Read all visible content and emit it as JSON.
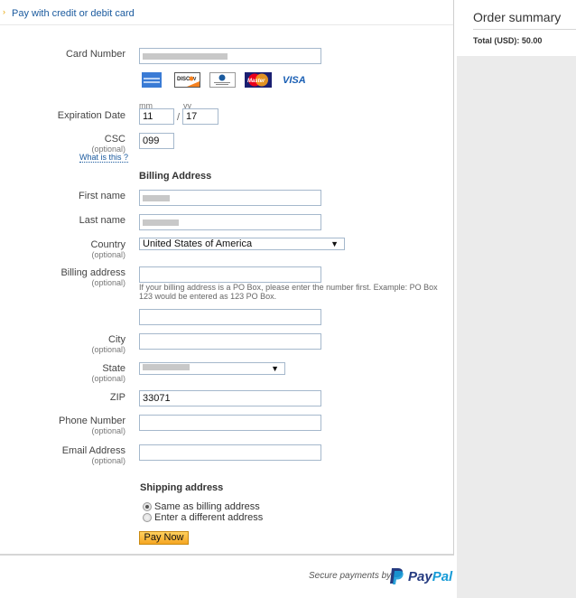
{
  "header": {
    "title": "Pay with credit or debit card",
    "chevron_icon": "chevron-right-icon"
  },
  "card": {
    "label": "Card Number",
    "value_redacted": true,
    "logos": [
      {
        "name": "amex",
        "label": "AMERICAN EXPRESS"
      },
      {
        "name": "discover",
        "label": "DISCOVER"
      },
      {
        "name": "diners-club",
        "label": "Diners Club International"
      },
      {
        "name": "mastercard",
        "label": "MasterCard"
      },
      {
        "name": "visa",
        "label": "VISA"
      }
    ]
  },
  "expiration": {
    "label": "Expiration Date",
    "mm_label": "mm",
    "yy_label": "yy",
    "mm_value": "11",
    "yy_value": "17",
    "separator": "/"
  },
  "csc": {
    "label": "CSC",
    "optional": "(optional)",
    "value": "099",
    "help_link": "What is this ?"
  },
  "billing": {
    "section_title": "Billing Address",
    "first_name_label": "First name",
    "last_name_label": "Last name",
    "country_label": "Country",
    "country_optional": "(optional)",
    "country_value": "United States of America",
    "address_label": "Billing address",
    "address_optional": "(optional)",
    "address_value": "",
    "address2_value": "",
    "po_box_hint": "If your billing address is a PO Box, please enter the number first. Example: PO Box 123 would be entered as 123 PO Box.",
    "city_label": "City",
    "city_optional": "(optional)",
    "city_value": "",
    "state_label": "State",
    "state_optional": "(optional)",
    "zip_label": "ZIP",
    "zip_value": "33071",
    "phone_label": "Phone Number",
    "phone_optional": "(optional)",
    "phone_value": "",
    "email_label": "Email Address",
    "email_optional": "(optional)",
    "email_value": ""
  },
  "shipping": {
    "section_title": "Shipping address",
    "options": [
      {
        "label": "Same as billing address",
        "checked": true
      },
      {
        "label": "Enter a different address",
        "checked": false
      }
    ]
  },
  "actions": {
    "pay_now": "Pay Now"
  },
  "footer": {
    "secure_text": "Secure payments by",
    "brand_pay": "Pay",
    "brand_pal": "Pal",
    "brand_colors": {
      "dark": "#253b80",
      "light": "#179bd7"
    }
  },
  "order_summary": {
    "title": "Order summary",
    "total_label": "Total (USD): 50.00"
  }
}
